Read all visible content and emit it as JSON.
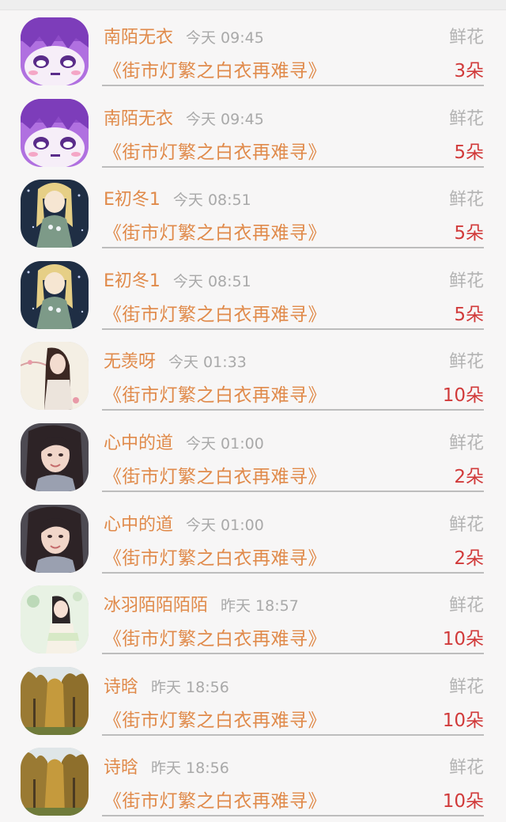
{
  "gift_label": "鲜花",
  "colors": {
    "name": "#e08a4a",
    "time": "#a9a9a9",
    "count": "#d13a3a",
    "gift_label": "#b3b3b3",
    "divider": "#bdbdbd"
  },
  "items": [
    {
      "avatar": "purple-anime-avatar",
      "name": "南陌无衣",
      "time": "今天 09:45",
      "book": "《街市灯繁之白衣再难寻》",
      "count": "3朵"
    },
    {
      "avatar": "purple-anime-avatar",
      "name": "南陌无衣",
      "time": "今天 09:45",
      "book": "《街市灯繁之白衣再难寻》",
      "count": "5朵"
    },
    {
      "avatar": "blonde-anime-avatar",
      "name": "E初冬1",
      "time": "今天 08:51",
      "book": "《街市灯繁之白衣再难寻》",
      "count": "5朵"
    },
    {
      "avatar": "blonde-anime-avatar",
      "name": "E初冬1",
      "time": "今天 08:51",
      "book": "《街市灯繁之白衣再难寻》",
      "count": "5朵"
    },
    {
      "avatar": "painted-woman-avatar",
      "name": "无羡呀",
      "time": "今天 01:33",
      "book": "《街市灯繁之白衣再难寻》",
      "count": "10朵"
    },
    {
      "avatar": "girl-photo-avatar",
      "name": "心中的道",
      "time": "今天 01:00",
      "book": "《街市灯繁之白衣再难寻》",
      "count": "2朵"
    },
    {
      "avatar": "girl-photo-avatar",
      "name": "心中的道",
      "time": "今天 01:00",
      "book": "《街市灯繁之白衣再难寻》",
      "count": "2朵"
    },
    {
      "avatar": "painted-girl-avatar",
      "name": "冰羽陌陌陌陌",
      "time": "昨天 18:57",
      "book": "《街市灯繁之白衣再难寻》",
      "count": "10朵"
    },
    {
      "avatar": "autumn-trees-avatar",
      "name": "诗晗",
      "time": "昨天 18:56",
      "book": "《街市灯繁之白衣再难寻》",
      "count": "10朵"
    },
    {
      "avatar": "autumn-trees-avatar",
      "name": "诗晗",
      "time": "昨天 18:56",
      "book": "《街市灯繁之白衣再难寻》",
      "count": "10朵"
    }
  ]
}
